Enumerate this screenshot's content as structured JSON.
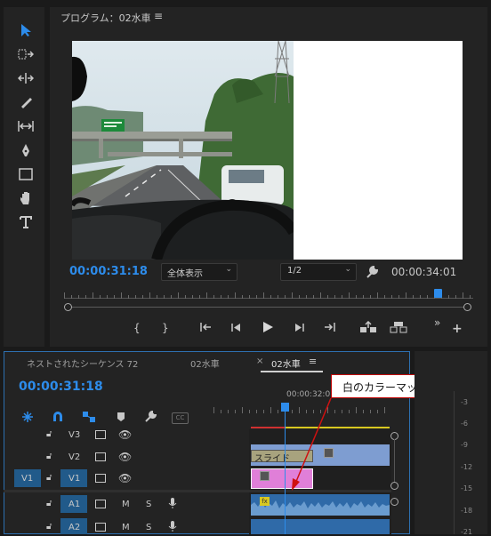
{
  "program_monitor": {
    "title": "プログラム：02水車",
    "menu_glyph": "≡",
    "current_time": "00:00:31:18",
    "duration": "00:00:34:01",
    "zoom_select": "全体表示",
    "resolution_select": "1/2"
  },
  "timeline": {
    "tabs": [
      {
        "label": "ネストされたシーケンス 72"
      },
      {
        "label": "02水車"
      },
      {
        "label": "02水車",
        "active": true
      }
    ],
    "close_glyph": "×",
    "menu_glyph": "≡",
    "current_time": "00:00:31:18",
    "ruler_time": "00:00:32:0",
    "tracks": [
      {
        "name": "V3",
        "type": "video"
      },
      {
        "name": "V2",
        "type": "video"
      },
      {
        "name": "V1",
        "type": "video",
        "source": "V1"
      },
      {
        "name": "A1",
        "type": "audio",
        "m": "M",
        "s": "S"
      },
      {
        "name": "A2",
        "type": "audio",
        "m": "M",
        "s": "S"
      }
    ],
    "clips": {
      "slide_label": "スライド",
      "fx_badge": "fx"
    }
  },
  "callout": {
    "text": "白のカラーマット"
  },
  "meter": {
    "levels": [
      "-3",
      "-6",
      "-9",
      "-12",
      "-15",
      "-18",
      "-21"
    ]
  },
  "colors": {
    "accent": "#2d8ceb",
    "clip_video": "#7e9dd1",
    "clip_pink": "#e07fd8",
    "callout_border": "#c00000",
    "audio_clip": "#2f6aa8"
  }
}
